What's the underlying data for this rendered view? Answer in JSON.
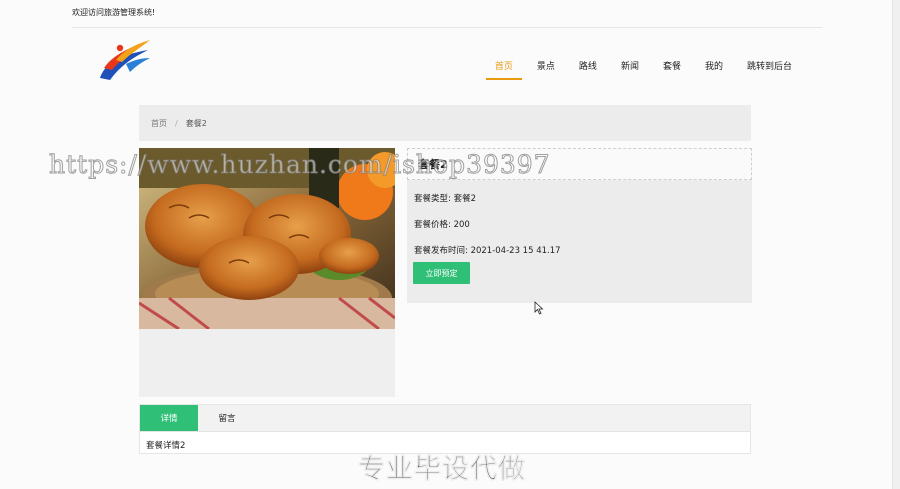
{
  "header": {
    "welcome": "欢迎访问旅游管理系统!",
    "logo": "logo-icon"
  },
  "nav": {
    "items": [
      "首页",
      "景点",
      "路线",
      "新闻",
      "套餐",
      "我的",
      "跳转到后台"
    ],
    "active_index": 0,
    "active_color": "#e89a11"
  },
  "breadcrumb": {
    "home": "首页",
    "separator": "/",
    "current": "套餐2"
  },
  "package": {
    "title": "套餐2",
    "type_label": "套餐类型:",
    "type_value": "套餐2",
    "price_label": "套餐价格:",
    "price_value": "200",
    "time_label": "套餐发布时间:",
    "time_value": "2021-04-23 15 41.17",
    "book_label": "立即预定",
    "accent": "#2fbf77",
    "image": "fried-chicken-photo"
  },
  "tabs": {
    "items": [
      "详情",
      "留言"
    ],
    "active_index": 0,
    "content": "套餐详情2"
  },
  "overlay": {
    "watermark": "https://www.huzhan.com/ishop39397",
    "caption": "专业毕设代做"
  }
}
